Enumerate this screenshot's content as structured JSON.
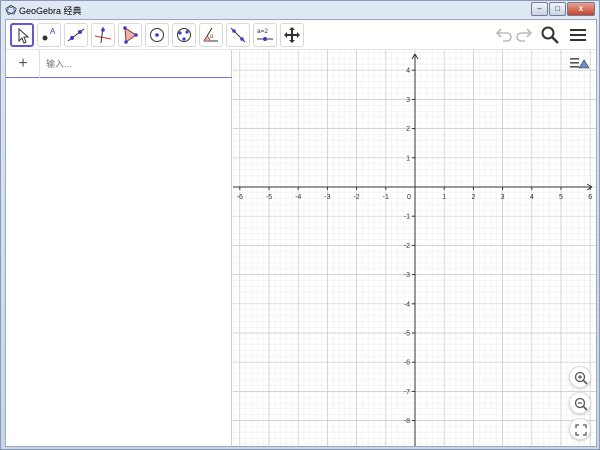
{
  "window": {
    "title": "GeoGebra 经典",
    "controls": {
      "minimize": "–",
      "maximize": "□",
      "close": "x"
    }
  },
  "toolbar": {
    "tools": [
      {
        "name": "move-tool",
        "icon": "arrow-pointer-icon",
        "selected": true
      },
      {
        "name": "point-tool",
        "icon": "point-icon",
        "label": "A"
      },
      {
        "name": "line-tool",
        "icon": "line-icon"
      },
      {
        "name": "perpendicular-tool",
        "icon": "perpendicular-icon"
      },
      {
        "name": "polygon-tool",
        "icon": "polygon-icon"
      },
      {
        "name": "circle-tool",
        "icon": "circle-icon"
      },
      {
        "name": "ellipse-tool",
        "icon": "ellipse-icon"
      },
      {
        "name": "angle-tool",
        "icon": "angle-icon",
        "label": "α"
      },
      {
        "name": "reflect-tool",
        "icon": "reflect-icon"
      },
      {
        "name": "slider-tool",
        "icon": "slider-icon",
        "label": "a=2"
      },
      {
        "name": "move-graphics-tool",
        "icon": "move-arrows-icon"
      }
    ],
    "right": [
      "undo-icon",
      "redo-icon",
      "search-icon",
      "menu-icon"
    ]
  },
  "algebra": {
    "add_label": "+",
    "input_placeholder": "输入..."
  },
  "graphics": {
    "x_ticks": [
      "-6",
      "-5",
      "-4",
      "-3",
      "-2",
      "-1",
      "0",
      "1",
      "2",
      "3",
      "4",
      "5",
      "6"
    ],
    "y_ticks_pos": [
      "4",
      "3",
      "2",
      "1"
    ],
    "y_ticks_neg": [
      "-1",
      "-2",
      "-3",
      "-4",
      "-5",
      "-6",
      "-7",
      "-8"
    ],
    "grid": true,
    "axis_color": "#333333",
    "grid_major_color": "#c8c8c8",
    "grid_minor_color": "#ececec",
    "accent": "#6557d2",
    "buttons": [
      "zoom-in-icon",
      "zoom-out-icon",
      "fullscreen-icon"
    ]
  }
}
